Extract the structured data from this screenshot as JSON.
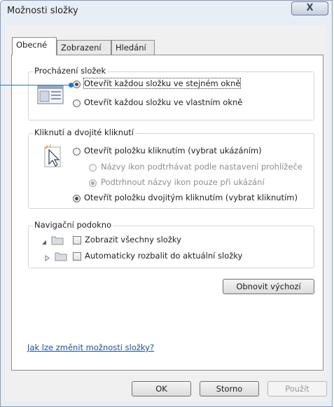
{
  "window": {
    "title": "Možnosti složky",
    "close_glyph": "X"
  },
  "tabs": [
    {
      "label": "Obecné",
      "active": true
    },
    {
      "label": "Zobrazení",
      "active": false
    },
    {
      "label": "Hledání",
      "active": false
    }
  ],
  "browse": {
    "legend": "Procházení složek",
    "icon": "folder-window-icon",
    "option_same": "Otevřít každou složku ve stejném okně",
    "option_own": "Otevřít každou složku ve vlastním okně",
    "selected": "same"
  },
  "click": {
    "legend": "Kliknutí a dvojité kliknutí",
    "icon": "cursor-click-icon",
    "option_single": "Otevřít položku kliknutím (vybrat ukázáním)",
    "sub_browser": "Názvy ikon podtrhávat podle nastavení prohlížeče",
    "sub_point": "Podtrhnout názvy ikon pouze při ukázání",
    "option_double": "Otevřít položku dvojitým kliknutím (vybrat kliknutím)",
    "selected": "double"
  },
  "nav": {
    "legend": "Navigační podokno",
    "show_all": "Zobrazit všechny složky",
    "auto_expand": "Automaticky rozbalit do aktuální složky"
  },
  "restore_label": "Obnovit výchozí",
  "help_link": "Jak lze změnit možnosti složky?",
  "buttons": {
    "ok": "OK",
    "cancel": "Storno",
    "apply": "Použít"
  },
  "colors": {
    "accent": "#1e7bbf",
    "link": "#1b4fa1"
  }
}
